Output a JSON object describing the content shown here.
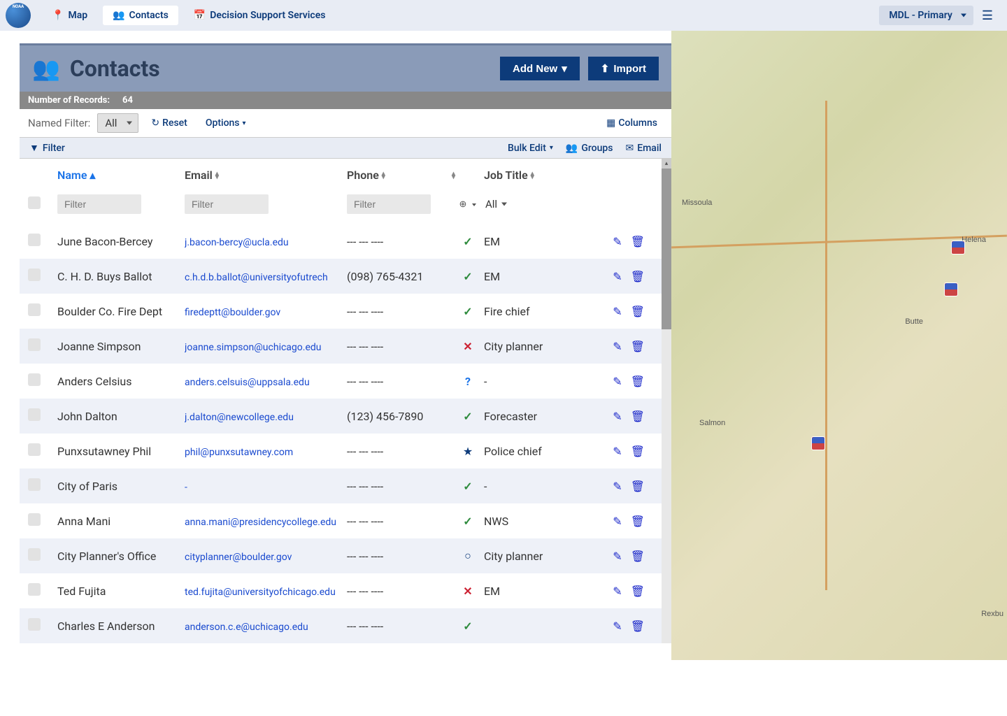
{
  "topnav": {
    "items": [
      {
        "label": "Map"
      },
      {
        "label": "Contacts"
      },
      {
        "label": "Decision Support Services"
      }
    ],
    "region": "MDL - Primary"
  },
  "header": {
    "title": "Contacts",
    "add_new": "Add New",
    "import": "Import"
  },
  "records": {
    "label": "Number of Records:",
    "count": "64"
  },
  "filterbar": {
    "named_label": "Named Filter:",
    "named_value": "All",
    "reset": "Reset",
    "options": "Options",
    "columns": "Columns"
  },
  "actionbar": {
    "filter": "Filter",
    "bulk_edit": "Bulk Edit",
    "groups": "Groups",
    "email": "Email"
  },
  "columns": {
    "name": "Name",
    "email": "Email",
    "phone": "Phone",
    "job": "Job Title"
  },
  "filter_placeholders": {
    "name": "Filter",
    "email": "Filter",
    "phone": "Filter",
    "job_value": "All"
  },
  "rows": [
    {
      "name": "June Bacon-Bercey",
      "email": "j.bacon-bercy@ucla.edu",
      "phone": "--- --- ----",
      "status": "check",
      "job": "EM"
    },
    {
      "name": "C. H. D. Buys Ballot",
      "email": "c.h.d.b.ballot@universityofutrech",
      "phone": "(098) 765-4321",
      "status": "check",
      "job": "EM"
    },
    {
      "name": "Boulder Co. Fire Dept",
      "email": "firedeptt@boulder.gov",
      "phone": "--- --- ----",
      "status": "check",
      "job": "Fire chief"
    },
    {
      "name": "Joanne Simpson",
      "email": "joanne.simpson@uchicago.edu",
      "phone": "--- --- ----",
      "status": "cross",
      "job": "City planner"
    },
    {
      "name": "Anders Celsius",
      "email": "anders.celsuis@uppsala.edu",
      "phone": "--- --- ----",
      "status": "question",
      "job": "-"
    },
    {
      "name": "John Dalton",
      "email": "j.dalton@newcollege.edu",
      "phone": "(123) 456-7890",
      "status": "check",
      "job": "Forecaster"
    },
    {
      "name": "Punxsutawney Phil",
      "email": "phil@punxsutawney.com",
      "phone": "--- --- ----",
      "status": "star",
      "job": "Police chief"
    },
    {
      "name": "City of Paris",
      "email": "-",
      "phone": "--- --- ----",
      "status": "check",
      "job": "-"
    },
    {
      "name": "Anna Mani",
      "email": "anna.mani@presidencycollege.edu",
      "phone": "--- --- ----",
      "status": "check",
      "job": "NWS"
    },
    {
      "name": "City Planner's Office",
      "email": "cityplanner@boulder.gov",
      "phone": "--- --- ----",
      "status": "circle",
      "job": "City planner"
    },
    {
      "name": "Ted Fujita",
      "email": "ted.fujita@universityofchicago.edu",
      "phone": "--- --- ----",
      "status": "cross",
      "job": "EM"
    },
    {
      "name": "Charles E Anderson",
      "email": "anderson.c.e@uchicago.edu",
      "phone": "--- --- ----",
      "status": "check",
      "job": ""
    }
  ],
  "map": {
    "labels": [
      "Missoula",
      "Helena",
      "Butte",
      "Salmon",
      "Rexbu"
    ]
  }
}
